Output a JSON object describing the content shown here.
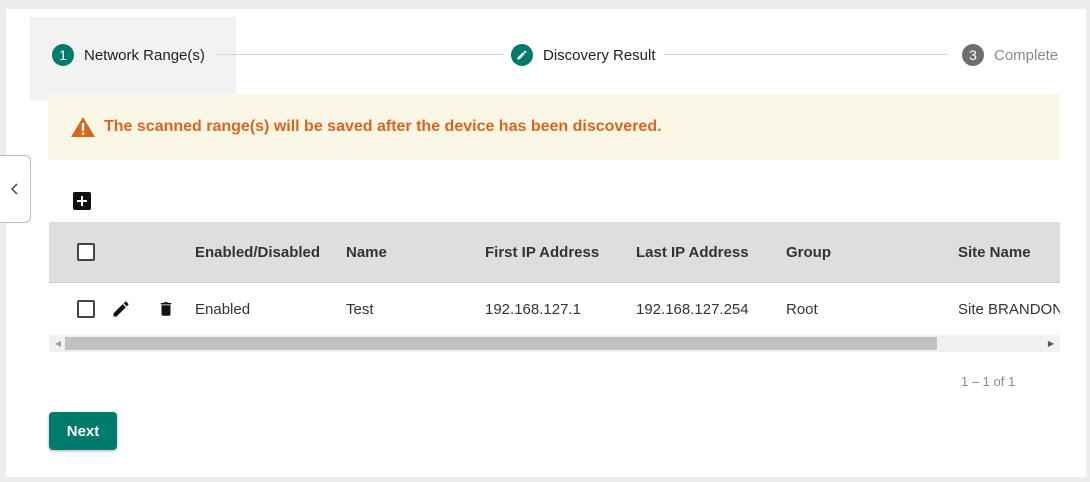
{
  "stepper": {
    "steps": [
      {
        "number": "1",
        "label": "Network Range(s)",
        "state": "active",
        "color": "#007a6b"
      },
      {
        "number": "",
        "label": "Discovery Result",
        "state": "edit",
        "icon": "pencil-icon",
        "color": "#007a6b"
      },
      {
        "number": "3",
        "label": "Complete",
        "state": "pending",
        "color": "#6e6e6e"
      }
    ]
  },
  "warning": {
    "text": "The scanned range(s) will be saved after the device has been discovered.",
    "color": "#d9661f",
    "icon": "warning-triangle-icon"
  },
  "toolbar": {
    "add_icon": "plus-square-icon"
  },
  "table": {
    "columns": [
      "Enabled/Disabled",
      "Name",
      "First IP Address",
      "Last IP Address",
      "Group",
      "Site Name"
    ],
    "rows": [
      {
        "checked": false,
        "enabled": "Enabled",
        "name": "Test",
        "first_ip": "192.168.127.1",
        "last_ip": "192.168.127.254",
        "group": "Root",
        "site_name": "Site BRANDONY"
      }
    ]
  },
  "paginator": {
    "range_label": "1 – 1 of 1"
  },
  "footer": {
    "next_label": "Next",
    "accent": "#007a6b"
  }
}
